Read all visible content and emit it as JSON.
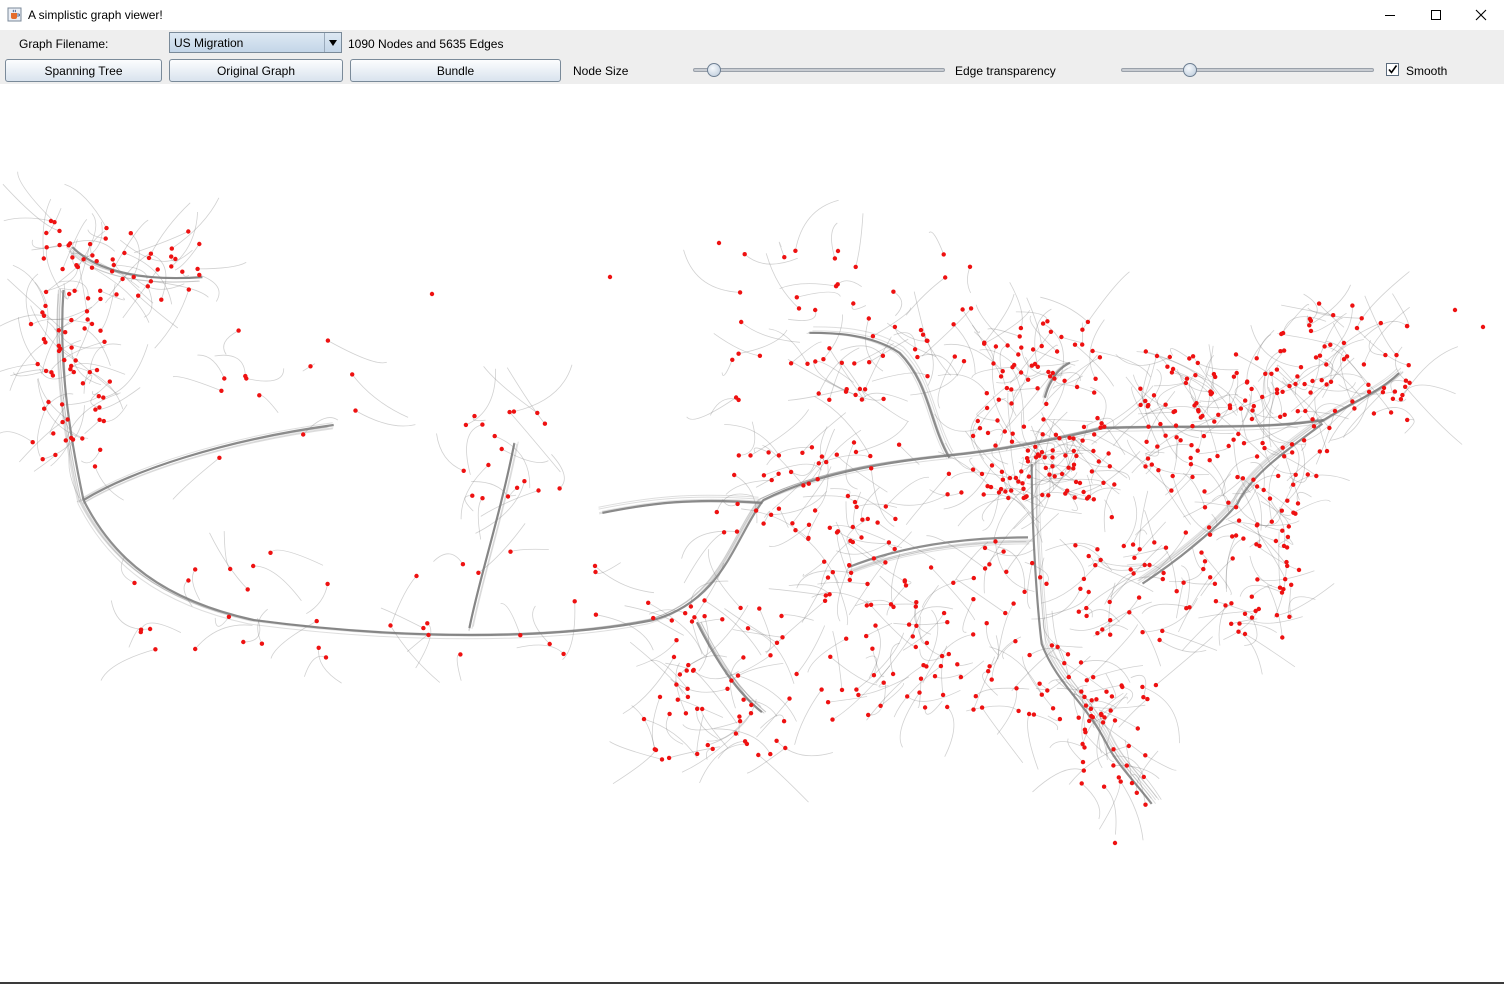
{
  "window": {
    "title": "A simplistic graph viewer!",
    "icon": "java-cup-icon"
  },
  "toolbar": {
    "filename_label": "Graph Filename:",
    "filename_value": "US Migration",
    "stats_text": "1090 Nodes and 5635 Edges",
    "spanning_tree_label": "Spanning Tree",
    "original_graph_label": "Original Graph",
    "bundle_label": "Bundle",
    "node_size_label": "Node Size",
    "node_size_value": 0.06,
    "edge_transparency_label": "Edge transparency",
    "edge_transparency_value": 0.26,
    "smooth_label": "Smooth",
    "smooth_checked": true
  },
  "graph": {
    "node_color": "#ee1111",
    "edge_color": "#7a7a7a",
    "background": "#ffffff"
  }
}
